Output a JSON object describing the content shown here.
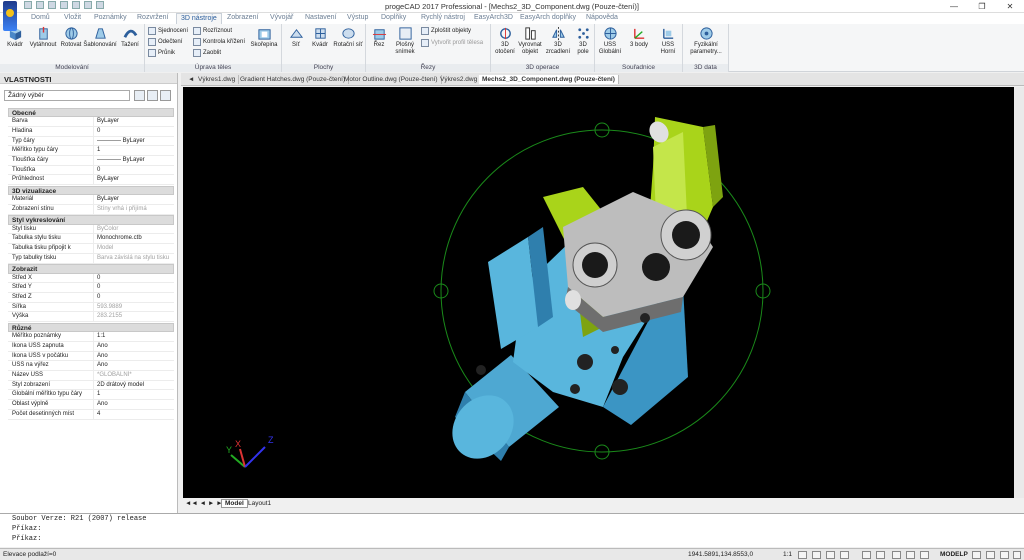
{
  "app": {
    "title": "progeCAD 2017 Professional - [Mechs2_3D_Component.dwg (Pouze-čtení)]",
    "controls": [
      "—",
      "❐",
      "✕"
    ]
  },
  "ribbon_tabs": [
    "Domů",
    "Vložit",
    "Poznámky",
    "Rozvržení",
    "3D nástroje",
    "Zobrazení",
    "Vývojář",
    "Nastavení",
    "Výstup",
    "Doplňky",
    "Rychlý nástroj",
    "EasyArch3D",
    "EasyArch doplňky",
    "Nápověda"
  ],
  "active_tab": "3D nástroje",
  "ribbon": {
    "modelovani": {
      "label": "Modelování",
      "buttons": [
        "Kvádr",
        "Vytáhnout",
        "Rotovat",
        "Šablonování",
        "Tažení"
      ]
    },
    "uprava": {
      "label": "Úprava těles",
      "small": [
        "Sjednocení",
        "Odečtení",
        "Průnik",
        "Rozříznout",
        "Kontrola křížení",
        "Zaoblit"
      ],
      "big": "Skořepina"
    },
    "plochy": {
      "label": "Plochy",
      "buttons": [
        "Síť",
        "Kvádr",
        "Rotační síť"
      ]
    },
    "rezy": {
      "label": "Řezy",
      "buttons": [
        "Řez",
        "Plošný snímek"
      ],
      "small": [
        "Zploštit objekty",
        "Vytvořit profil tělesa"
      ]
    },
    "operace": {
      "label": "3D operace",
      "buttons": [
        "3D otočení",
        "Vyrovnat objekt",
        "3D zrcadlení",
        "3D pole"
      ]
    },
    "soulad": {
      "label": "Souřadnice",
      "buttons": [
        "USS Globální",
        "3 body",
        "USS Horní"
      ]
    },
    "data": {
      "label": "3D data",
      "buttons": [
        "Fyzikální parametry..."
      ]
    }
  },
  "properties": {
    "title": "VLASTNOSTI",
    "selection": "Žádný výběr",
    "sections": [
      {
        "name": "Obecné",
        "rows": [
          [
            "Barva",
            "ByLayer",
            ""
          ],
          [
            "Hladina",
            "0",
            ""
          ],
          [
            "Typ čáry",
            "———— ByLayer",
            ""
          ],
          [
            "Měřítko typu čáry",
            "1",
            ""
          ],
          [
            "Tloušťka čáry",
            "———— ByLayer",
            ""
          ],
          [
            "Tloušťka",
            "0",
            ""
          ],
          [
            "Průhlednost",
            "ByLayer",
            ""
          ]
        ]
      },
      {
        "name": "3D vizualizace",
        "rows": [
          [
            "Materiál",
            "ByLayer",
            ""
          ],
          [
            "Zobrazení stínu",
            "Stíny vrhá i přijímá",
            "dim"
          ]
        ]
      },
      {
        "name": "Styl vykreslování",
        "rows": [
          [
            "Styl tisku",
            "ByColor",
            "dim"
          ],
          [
            "Tabulka stylu tisku",
            "Monochrome.ctb",
            ""
          ],
          [
            "Tabulka tisku připojit k",
            "Model",
            "dim"
          ],
          [
            "Typ tabulky tisku",
            "Barva závislá na stylu tisku",
            "dim"
          ]
        ]
      },
      {
        "name": "Zobrazit",
        "rows": [
          [
            "Střed X",
            "0",
            ""
          ],
          [
            "Střed Y",
            "0",
            ""
          ],
          [
            "Střed Z",
            "0",
            ""
          ],
          [
            "Šířka",
            "593.9889",
            "dim"
          ],
          [
            "Výška",
            "283.2155",
            "dim"
          ]
        ]
      },
      {
        "name": "Různé",
        "rows": [
          [
            "Měřítko poznámky",
            "1:1",
            ""
          ],
          [
            "Ikona USS zapnuta",
            "Ano",
            ""
          ],
          [
            "Ikona USS v počátku",
            "Ano",
            ""
          ],
          [
            "USS na výřez",
            "Ano",
            ""
          ],
          [
            "Název USS",
            "*GLOBÁLNÍ*",
            "dim"
          ],
          [
            "Styl zobrazení",
            "2D drátový model",
            ""
          ],
          [
            "Globální měřítko typu čáry",
            "1",
            ""
          ],
          [
            "Oblast výplně",
            "Ano",
            ""
          ],
          [
            "Počet desetinných míst",
            "4",
            ""
          ]
        ]
      }
    ]
  },
  "doc_tabs": [
    "Výkres1.dwg",
    "Gradient Hatches.dwg (Pouze-čtení)",
    "Motor Outline.dwg (Pouze-čtení)",
    "Výkres2.dwg",
    "Mechs2_3D_Component.dwg (Pouze-čtení)"
  ],
  "active_doc": "Mechs2_3D_Component.dwg (Pouze-čtení)",
  "layout_tabs": [
    "Model",
    "Layout1"
  ],
  "ucs_labels": {
    "x": "X",
    "y": "Y",
    "z": "Z"
  },
  "command": [
    "Soubor Verze: R21 (2007) release",
    "Příkaz:",
    "Příkaz:"
  ],
  "status": {
    "left": "Elevace podlaží=0",
    "coords": "1941.5891,134.8553,0",
    "scale": "1:1",
    "model": "MODELP"
  },
  "colors": {
    "viewport_bg": "#000000",
    "lime": "#a9d41a",
    "blue": "#59b6dd",
    "orbit": "#1a8a1a"
  }
}
